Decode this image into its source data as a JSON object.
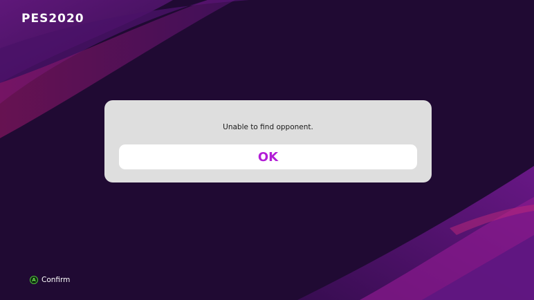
{
  "header": {
    "logo": "PES2020"
  },
  "dialog": {
    "message": "Unable to find opponent.",
    "ok_label": "OK"
  },
  "footer": {
    "confirm_button_glyph": "A",
    "confirm_label": "Confirm"
  },
  "colors": {
    "background": "#200a33",
    "dialog_background": "#dedede",
    "ok_text": "#b21ed6",
    "accent_swoosh": "#8a1aa8",
    "confirm_icon": "#4fbf3a"
  },
  "icons": {
    "confirm": "a-button-icon"
  }
}
